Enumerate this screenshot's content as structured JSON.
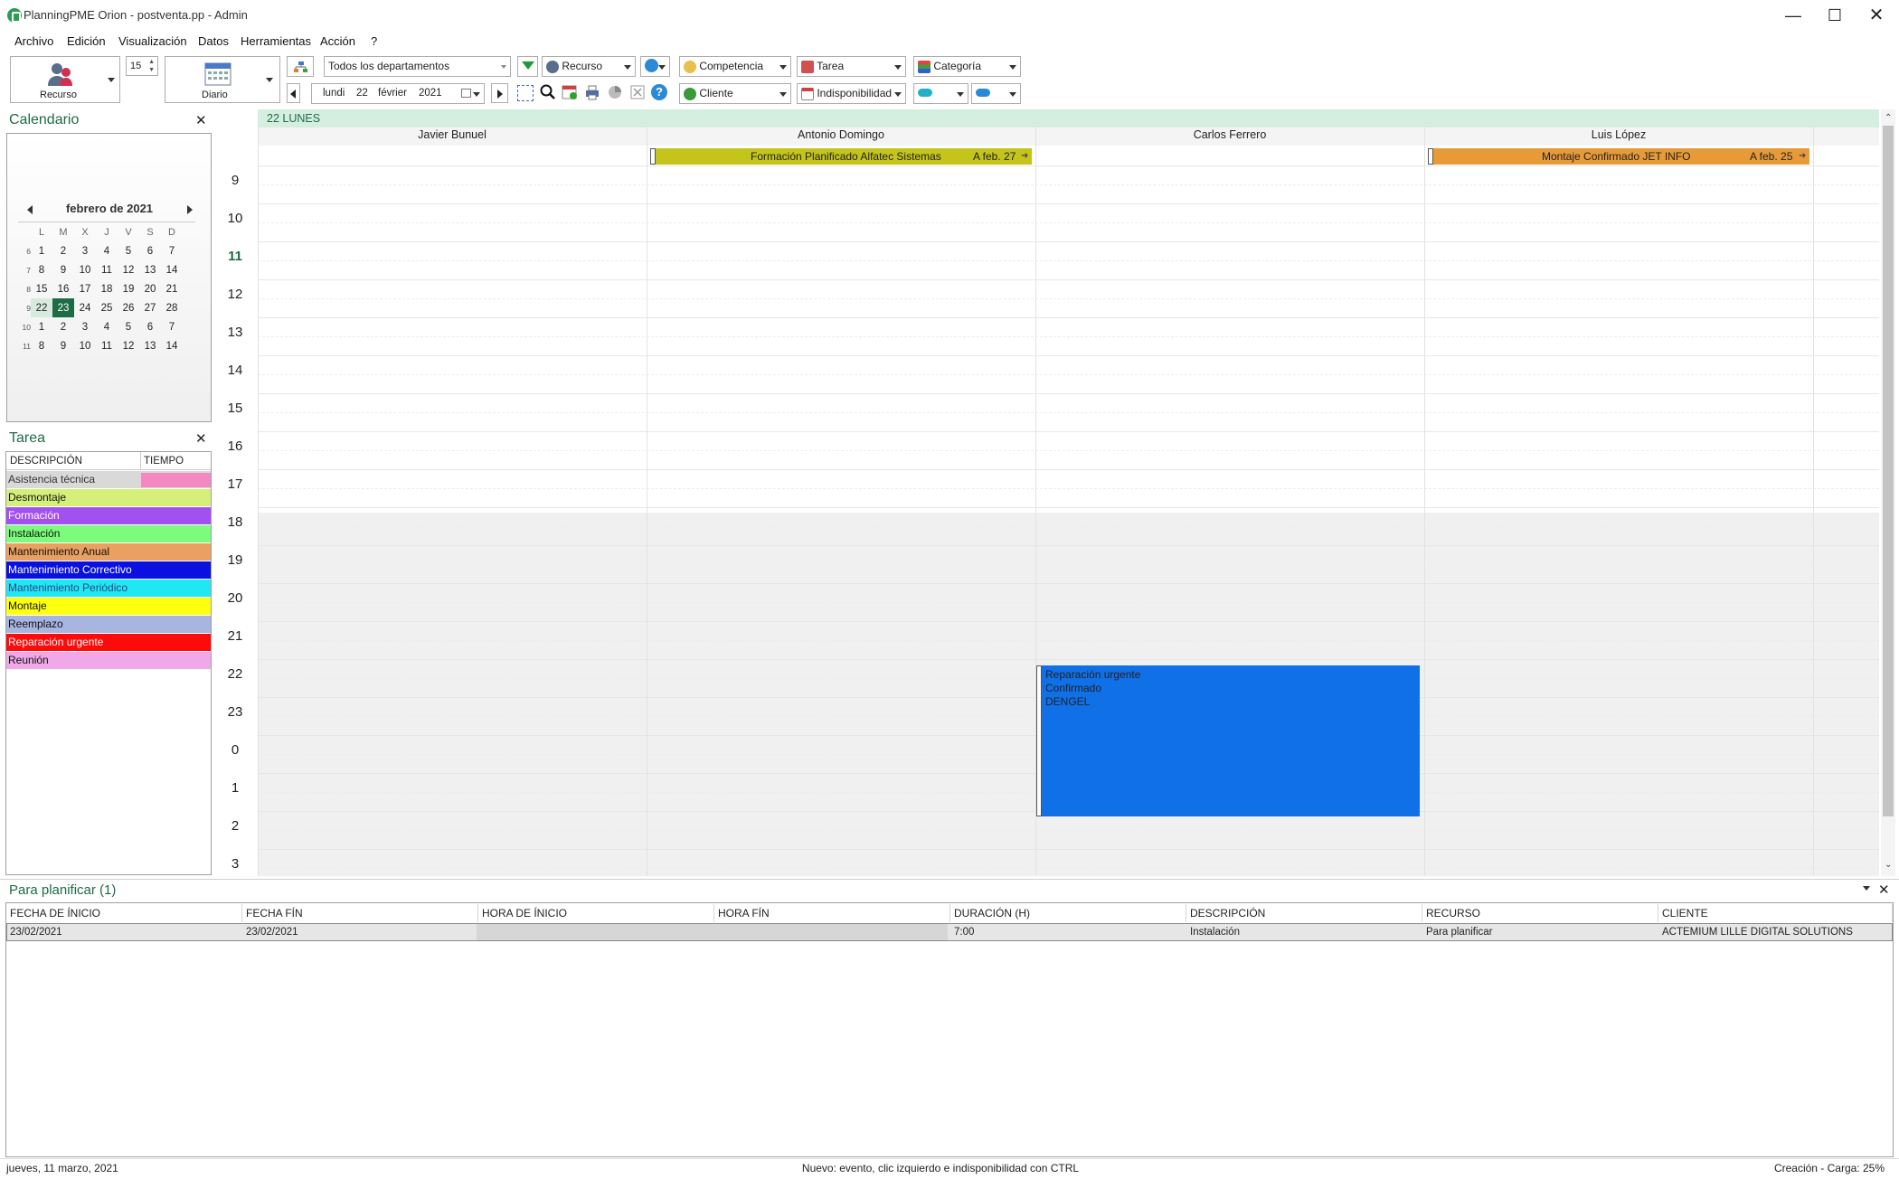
{
  "window": {
    "title": "PlanningPME Orion - postventa.pp - Admin"
  },
  "menu": [
    "Archivo",
    "Edición",
    "Visualización",
    "Datos",
    "Herramientas",
    "Acción",
    "?"
  ],
  "toolbar": {
    "view_resource": "Recurso",
    "view_mode": "Diario",
    "spin_value": "15",
    "departments": "Todos los departamentos",
    "filter_resource": "Recurso",
    "filter_competence": "Competencia",
    "filter_task": "Tarea",
    "filter_category": "Categoría",
    "filter_client": "Cliente",
    "filter_unavailability": "Indisponibilidad",
    "date": {
      "weekday": "lundi",
      "day": "22",
      "month": "février",
      "year": "2021"
    }
  },
  "calendar_panel": {
    "title": "Calendario",
    "month_label": "febrero de 2021",
    "day_headers": [
      "L",
      "M",
      "X",
      "J",
      "V",
      "S",
      "D"
    ],
    "weeks": [
      {
        "wk": "6",
        "days": [
          "1",
          "2",
          "3",
          "4",
          "5",
          "6",
          "7"
        ]
      },
      {
        "wk": "7",
        "days": [
          "8",
          "9",
          "10",
          "11",
          "12",
          "13",
          "14"
        ]
      },
      {
        "wk": "8",
        "days": [
          "15",
          "16",
          "17",
          "18",
          "19",
          "20",
          "21"
        ]
      },
      {
        "wk": "9",
        "days": [
          "22",
          "23",
          "24",
          "25",
          "26",
          "27",
          "28"
        ]
      },
      {
        "wk": "10",
        "days": [
          "1",
          "2",
          "3",
          "4",
          "5",
          "6",
          "7"
        ]
      },
      {
        "wk": "11",
        "days": [
          "8",
          "9",
          "10",
          "11",
          "12",
          "13",
          "14"
        ]
      }
    ]
  },
  "task_panel": {
    "title": "Tarea",
    "col_desc": "DESCRIPCIÓN",
    "col_time": "TIEMPO",
    "items": [
      {
        "label": "Asistencia técnica",
        "color": "#d9d9d9",
        "text": "#333333"
      },
      {
        "label": "Desmontaje",
        "color": "#d4f07a",
        "text": "#111111"
      },
      {
        "label": "Formación",
        "color": "#a350f0",
        "text": "#ffffff"
      },
      {
        "label": "Instalación",
        "color": "#7cfc7c",
        "text": "#111111"
      },
      {
        "label": "Mantenimiento Anual",
        "color": "#e9a060",
        "text": "#111111"
      },
      {
        "label": "Mantenimiento Correctivo",
        "color": "#0a10e0",
        "text": "#ffffff"
      },
      {
        "label": "Mantenimiento Periódico",
        "color": "#1ee8f0",
        "text": "#334488"
      },
      {
        "label": "Montaje",
        "color": "#ffff10",
        "text": "#111111"
      },
      {
        "label": "Reemplazo",
        "color": "#a7b5e0",
        "text": "#111111"
      },
      {
        "label": "Reparación urgente",
        "color": "#ff0a0a",
        "text": "#ffffff"
      },
      {
        "label": "Reunión",
        "color": "#f0a8e8",
        "text": "#111111"
      }
    ]
  },
  "planner": {
    "day_label": "22 LUNES",
    "resources": [
      "Javier Bunuel",
      "Antonio Domingo",
      "Carlos Ferrero",
      "Luis López"
    ],
    "hours": [
      "9",
      "10",
      "11",
      "12",
      "13",
      "14",
      "15",
      "16",
      "17",
      "18",
      "19",
      "20",
      "21",
      "22",
      "23",
      "0",
      "1",
      "2",
      "3"
    ],
    "allday": [
      {
        "text": "Formación Planificado Alfatec Sistemas",
        "until": "A feb. 27",
        "color": "#c4c41a"
      },
      {
        "text": "Montaje Confirmado JET INFO",
        "until": "A feb. 25",
        "color": "#e89a38"
      }
    ],
    "event": {
      "line1": "Reparación urgente",
      "line2": "Confirmado",
      "line3": "DENGEL",
      "color": "#1070e8"
    }
  },
  "to_plan": {
    "title": "Para planificar (1)",
    "columns": [
      "FECHA DE ÍNICIO",
      "FECHA FÍN",
      "HORA DE ÍNICIO",
      "HORA FÍN",
      "DURACIÓN (H)",
      "DESCRIPCIÓN",
      "RECURSO",
      "CLIENTE"
    ],
    "row": [
      "23/02/2021",
      "23/02/2021",
      "",
      "",
      "7:00",
      "Instalación",
      "Para planificar",
      "ACTEMIUM LILLE DIGITAL SOLUTIONS"
    ]
  },
  "status": {
    "left": "jueves, 11 marzo, 2021",
    "center": "Nuevo: evento, clic izquierdo e indisponibilidad con CTRL",
    "right": "Creación - Carga: 25%"
  }
}
